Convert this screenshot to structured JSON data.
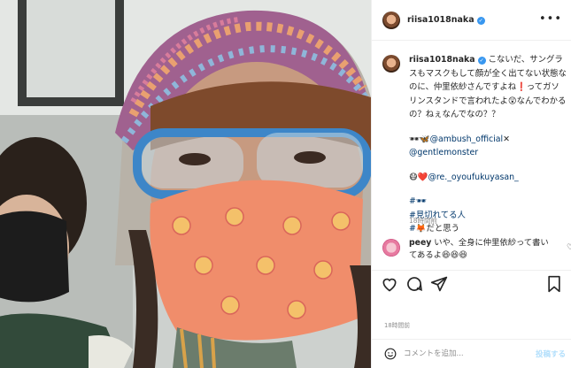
{
  "post": {
    "username": "riisa1018naka",
    "verified": true,
    "more_label": "•••"
  },
  "caption": {
    "username": "riisa1018naka",
    "text_1": "こないだ、サングラスもマスクもして顔が全く出てない状態なのに、仲里依紗さんですよね❗️ってガソリンスタンドで言われたよ😲なんでわかるの？ねぇなんでなの？？",
    "credit_icons": "🕶🦋",
    "credit_1": "@ambush_official",
    "credit_1_suffix": "✕",
    "credit_2": "@gentlemonster",
    "mask_icons": "😷❤️",
    "credit_3": "@re._oyoufukuyasan_",
    "hashtag_icons": "#🕶",
    "hashtag_1": "#見切れてる人",
    "hashtag_2_icon": "#🦊",
    "hashtag_2_text": "だと思う",
    "time": "18時間前"
  },
  "comment": {
    "username": "peey",
    "text": "いや、全身に仲里依紗って書いてあるよ😆😆😆"
  },
  "actions": {
    "like": "heart-icon",
    "comment": "comment-icon",
    "share": "share-icon",
    "save": "bookmark-icon"
  },
  "timestamp": "18時間前",
  "add_comment": {
    "placeholder": "コメントを追加...",
    "post_label": "投稿する"
  },
  "colors": {
    "verified": "#3897f0",
    "link": "#00376b",
    "post_disabled": "#b2dffc"
  }
}
